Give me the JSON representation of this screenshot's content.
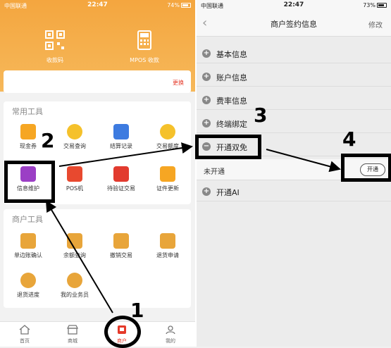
{
  "left": {
    "status": {
      "carrier": "中国联通",
      "time": "22:47",
      "battery": "74%"
    },
    "quick_actions": [
      "收款码",
      "MPOS 收款"
    ],
    "notice_more": "更换",
    "common_tools": {
      "title": "常用工具",
      "items": [
        "现金券",
        "交易查询",
        "结算记录",
        "交易额度",
        "信息维护",
        "POS机",
        "待验证交易",
        "证件更新"
      ]
    },
    "merchant_tools": {
      "title": "商户工具",
      "items": [
        "单边账确认",
        "余额查询",
        "撤销交易",
        "退货申请",
        "退货进度",
        "我的业务员"
      ]
    },
    "tabs": [
      "首页",
      "商城",
      "商户",
      "我的"
    ]
  },
  "right": {
    "status": {
      "carrier": "中国联通",
      "time": "22:47",
      "battery": "73%"
    },
    "nav": {
      "title": "商户签约信息",
      "edit": "修改"
    },
    "sections": [
      "基本信息",
      "账户信息",
      "费率信息",
      "终端绑定",
      "开通双免",
      "开通AI"
    ],
    "open_row": {
      "label": "未开通",
      "button": "开通"
    }
  },
  "annotations": [
    "1",
    "2",
    "3",
    "4"
  ],
  "colors": {
    "brand_orange": "#f4a63f",
    "accent_red": "#e53a2a"
  }
}
